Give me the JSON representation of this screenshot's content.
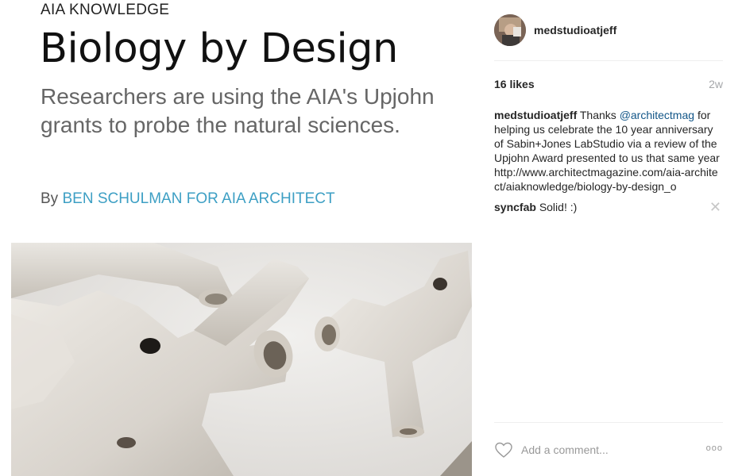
{
  "article": {
    "kicker": "AIA KNOWLEDGE",
    "headline": "Biology by Design",
    "subhead": "Researchers are using the AIA's Upjohn grants to probe the natural sciences.",
    "byline_prefix": "By",
    "byline_author": "BEN SCHULMAN FOR AIA ARCHITECT"
  },
  "post": {
    "username": "medstudioatjeff",
    "likes": "16 likes",
    "time_ago": "2w"
  },
  "comments": [
    {
      "username": "medstudioatjeff",
      "text_before": "Thanks",
      "mention": "@architectmag",
      "text_after": "for helping us celebrate the 10 year anniversary of Sabin+Jones LabStudio via a review of the Upjohn Award presented to us that same year",
      "link": "http://www.architectmagazine.com/aia-architect/aiaknowledge/biology-by-design_o"
    },
    {
      "username": "syncfab",
      "text": "Solid! :)"
    }
  ],
  "composer": {
    "placeholder": "Add a comment...",
    "more_label": "ooo"
  },
  "icons": {
    "like": "heart-icon",
    "delete": "close-icon",
    "more": "more-options-icon"
  },
  "colors": {
    "byline_author": "#3d9fc4",
    "mention": "#125688",
    "timestamp": "#a5a7aa",
    "divider": "#efefef"
  }
}
